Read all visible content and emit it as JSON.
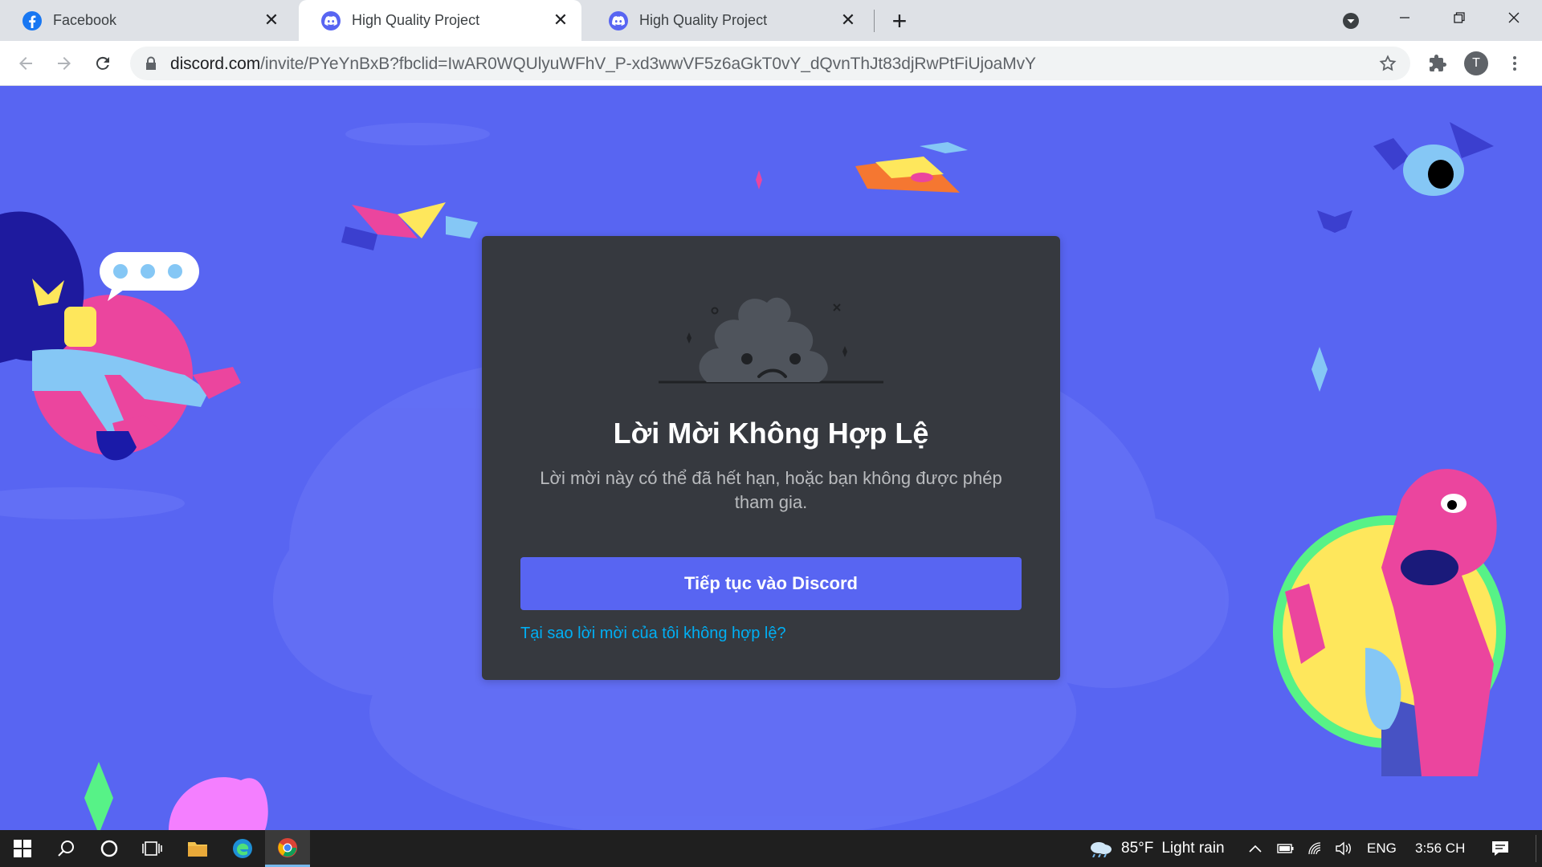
{
  "browser": {
    "tabs": [
      {
        "title": "Facebook",
        "favicon": "facebook-icon",
        "active": false
      },
      {
        "title": "High Quality Project",
        "favicon": "discord-icon",
        "active": true
      },
      {
        "title": "High Quality Project",
        "favicon": "discord-icon",
        "active": false
      }
    ],
    "new_tab_glyph": "+",
    "close_glyph": "✕",
    "profile_initial": "T",
    "url_host": "discord.com",
    "url_path": "/invite/PYeYnBxB?fbclid=IwAR0WQUlyuWFhV_P-xd3wwVF5z6aGkT0vY_dQvnThJt83djRwPtFiUjoaMvY"
  },
  "invite": {
    "title": "Lời Mời Không Hợp Lệ",
    "description": "Lời mời này có thể đã hết hạn, hoặc bạn không được phép tham gia.",
    "continue_label": "Tiếp tục vào Discord",
    "why_link": "Tại sao lời mời của tôi không hợp lệ?",
    "illustration": "sad-poop-icon"
  },
  "taskbar": {
    "weather_temp": "85°F",
    "weather_text": "Light rain",
    "language": "ENG",
    "clock": "3:56 CH"
  },
  "colors": {
    "blurple": "#5865f2",
    "card": "#36393f",
    "link": "#00aff4",
    "muted_text": "#b9bbbe"
  }
}
